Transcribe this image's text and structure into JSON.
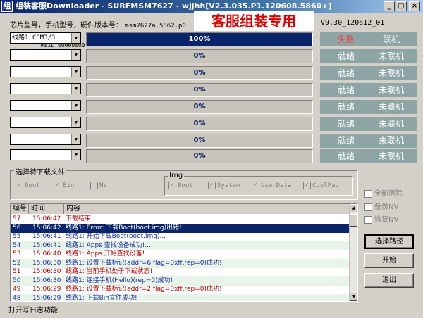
{
  "window": {
    "logo_char": "组",
    "title": "组装客服Downloader - SURFMSM7627 - wjjhh[V2.3.035.P1.120608.5860+]",
    "minimize": "_",
    "maximize": "□",
    "close": "×"
  },
  "info": {
    "label": "芯片型号，手机型号，硬件版本号：",
    "value": "msm7627a.5862.p0",
    "banner": "客服组装专用",
    "version": "V9.30_120612_01"
  },
  "lines": [
    {
      "port": "线路1  COM3/3",
      "meid": "MEID 00000000",
      "progress": 1.0,
      "progress_text": "100%",
      "status1": "失败",
      "status2": "联机",
      "failed": true
    },
    {
      "port": "",
      "progress": 0,
      "progress_text": "0%",
      "status1": "就绪",
      "status2": "未联机"
    },
    {
      "port": "",
      "progress": 0,
      "progress_text": "0%",
      "status1": "就绪",
      "status2": "未联机"
    },
    {
      "port": "",
      "progress": 0,
      "progress_text": "0%",
      "status1": "就绪",
      "status2": "未联机"
    },
    {
      "port": "",
      "progress": 0,
      "progress_text": "0%",
      "status1": "就绪",
      "status2": "未联机"
    },
    {
      "port": "",
      "progress": 0,
      "progress_text": "0%",
      "status1": "就绪",
      "status2": "未联机"
    },
    {
      "port": "",
      "progress": 0,
      "progress_text": "0%",
      "status1": "就绪",
      "status2": "未联机"
    },
    {
      "port": "",
      "progress": 0,
      "progress_text": "0%",
      "status1": "就绪",
      "status2": "未联机"
    }
  ],
  "files_group": {
    "label": "选择待下载文件",
    "checks": [
      {
        "label": "Boot",
        "checked": true
      },
      {
        "label": "Bin",
        "checked": true
      },
      {
        "label": "NV",
        "checked": false
      }
    ],
    "img_label": "Img",
    "img_checks": [
      {
        "label": "Boot",
        "checked": true
      },
      {
        "label": "System",
        "checked": true
      },
      {
        "label": "UserData",
        "checked": true
      },
      {
        "label": "CoolPad",
        "checked": true
      }
    ]
  },
  "options": [
    {
      "label": "全部擦除"
    },
    {
      "label": "备份NV"
    },
    {
      "label": "恢复NV"
    }
  ],
  "log": {
    "headers": [
      "编号",
      "时间",
      "内容"
    ],
    "rows": [
      {
        "num": "57",
        "time": "15:06:42",
        "text": "下载结束",
        "type": "err"
      },
      {
        "num": "56",
        "time": "15:06:42",
        "text": "线路1: Error: 下载Boot(boot.img)出错!",
        "type": "sel"
      },
      {
        "num": "55",
        "time": "15:06:41",
        "text": "线路1: 开始下载Boot(boot.img)...",
        "type": "info"
      },
      {
        "num": "54",
        "time": "15:06:41",
        "text": "线路1: Apps 查找设备成功!...",
        "type": "info"
      },
      {
        "num": "53",
        "time": "15:06:40",
        "text": "线路1: Apps 开始查找设备!...",
        "type": "err"
      },
      {
        "num": "52",
        "time": "15:06:30",
        "text": "线路1: 设置下载标记(addr=6,flag=0xff,rep=0)成功!",
        "type": "info"
      },
      {
        "num": "51",
        "time": "15:06:30",
        "text": "线路1: 当前手机处于下载状态!",
        "type": "err"
      },
      {
        "num": "50",
        "time": "15:06:30",
        "text": "线路1: 连接手机(Hello)(rep=0)成功!",
        "type": "info"
      },
      {
        "num": "49",
        "time": "15:06:29",
        "text": "线路1: 设置下载标记(addr=2,flag=0xff,rep=0)成功!",
        "type": "err"
      },
      {
        "num": "48",
        "time": "15:06:29",
        "text": "线路1: 下载Bin文件成功!",
        "type": "info"
      }
    ]
  },
  "buttons": {
    "select_path": "选择路径",
    "start": "开始",
    "exit": "退出"
  },
  "status_bar": "打开写日志功能"
}
